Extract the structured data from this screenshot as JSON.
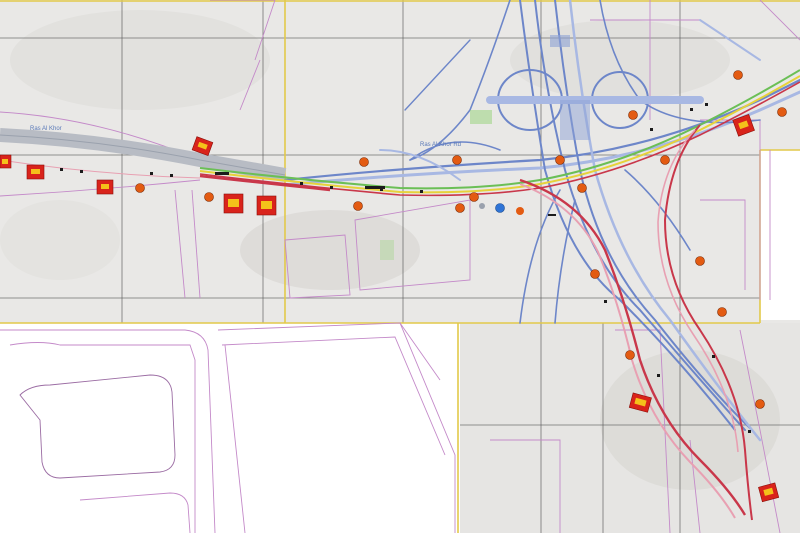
{
  "map": {
    "labels": {
      "road_west": "Ras Al Khor",
      "road_mid": "Ras Al Khor Rd"
    },
    "colors": {
      "terrain": "#e9e8e6",
      "terrain_shade": "#d9d8d5",
      "white_sheet": "#ffffff",
      "sheet_border": "#e2c94a",
      "tile_grid": "#5d5d5d",
      "parcel": "#c48ac9",
      "interchange_blue": "#6d86c9",
      "diversion_red": "#c9374a",
      "diversion_pink": "#e8a0b2",
      "diversion_green": "#6bbf56",
      "diversion_yellow": "#e6d23a",
      "marker_orange": "#e35b12",
      "marker_red": "#d9231b"
    },
    "icons": [
      "traffic-cone-icon",
      "warning-sign-icon",
      "direction-arrow-icon"
    ]
  }
}
